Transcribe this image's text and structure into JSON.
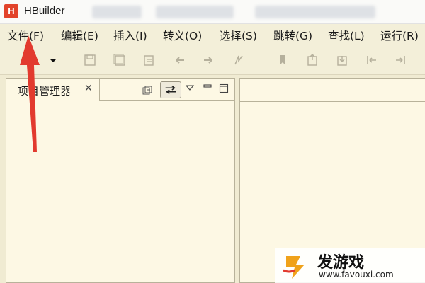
{
  "window": {
    "app_name": "HBuilder",
    "logo_letter": "H"
  },
  "menu": [
    {
      "label": "文件(F)"
    },
    {
      "label": "编辑(E)"
    },
    {
      "label": "插入(I)"
    },
    {
      "label": "转义(O)"
    },
    {
      "label": "选择(S)"
    },
    {
      "label": "跳转(G)"
    },
    {
      "label": "查找(L)"
    },
    {
      "label": "运行(R)"
    }
  ],
  "toolbar": {
    "icons": [
      "dropdown-arrow-icon",
      "save-icon",
      "save-all-icon",
      "save-as-icon",
      "undo-icon",
      "redo-icon",
      "format-icon",
      "bookmark-icon",
      "export-icon",
      "import-icon",
      "step-in-icon",
      "step-out-icon"
    ]
  },
  "project_panel": {
    "tab_label": "项目管理器",
    "close_glyph": "✕"
  },
  "watermark": {
    "text": "发游戏",
    "url": "www.favouxi.com"
  },
  "colors": {
    "accent_red": "#e23a2e",
    "panel_bg": "#fdf8e4",
    "chrome_bg": "#f3efd9"
  }
}
